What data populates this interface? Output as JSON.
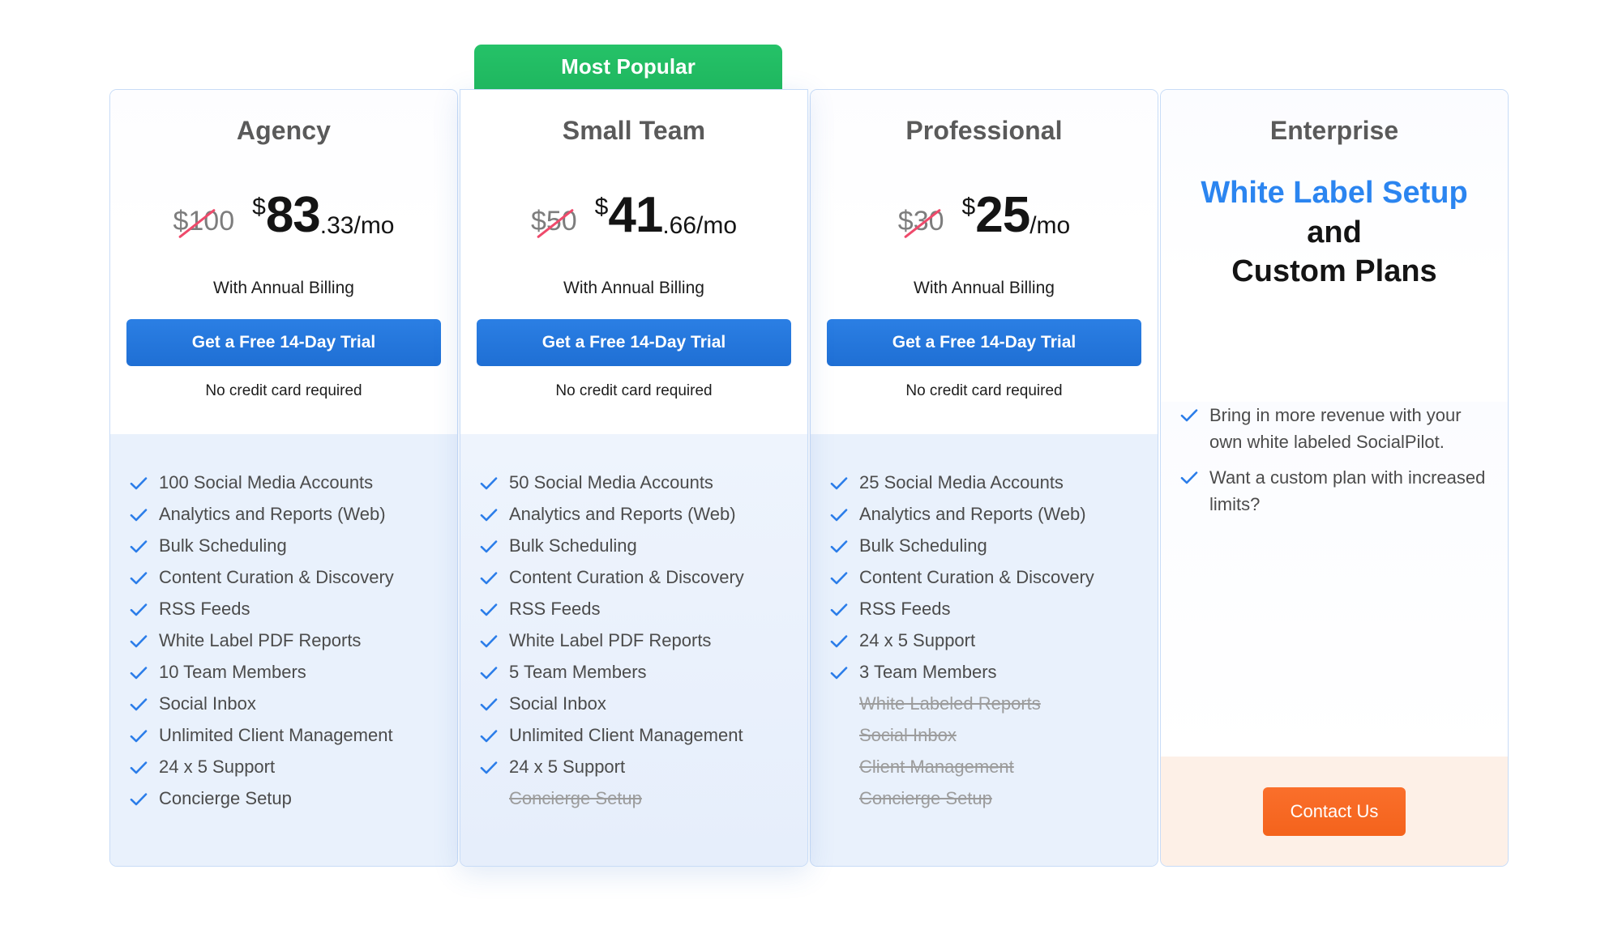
{
  "badge": {
    "label": "Most Popular"
  },
  "colors": {
    "accent_blue": "#2b7de9",
    "badge_green": "#1fb75f",
    "contact_orange": "#f4631c",
    "strike_red": "#ef4a6b",
    "feature_bg": "#e9f1fc",
    "enterprise_footer_bg": "#fdf0e7",
    "muted_text": "#9c9c9c"
  },
  "plans": [
    {
      "name": "Agency",
      "old_price": "$100",
      "currency": "$",
      "price_int": "83",
      "price_frac": ".33/mo",
      "billing_note": "With Annual Billing",
      "cta_label": "Get a Free 14-Day Trial",
      "cta_note": "No credit card required",
      "features": [
        {
          "label": "100 Social Media Accounts",
          "included": true
        },
        {
          "label": "Analytics and Reports (Web)",
          "included": true
        },
        {
          "label": "Bulk Scheduling",
          "included": true
        },
        {
          "label": "Content Curation & Discovery",
          "included": true
        },
        {
          "label": "RSS Feeds",
          "included": true
        },
        {
          "label": "White Label PDF Reports",
          "included": true
        },
        {
          "label": "10 Team Members",
          "included": true
        },
        {
          "label": "Social Inbox",
          "included": true
        },
        {
          "label": "Unlimited Client Management",
          "included": true
        },
        {
          "label": "24 x 5 Support",
          "included": true
        },
        {
          "label": "Concierge Setup",
          "included": true
        }
      ]
    },
    {
      "name": "Small Team",
      "old_price": "$50",
      "currency": "$",
      "price_int": "41",
      "price_frac": ".66/mo",
      "billing_note": "With Annual Billing",
      "cta_label": "Get a Free 14-Day Trial",
      "cta_note": "No credit card required",
      "popular": true,
      "features": [
        {
          "label": "50 Social Media Accounts",
          "included": true
        },
        {
          "label": "Analytics and Reports (Web)",
          "included": true
        },
        {
          "label": "Bulk Scheduling",
          "included": true
        },
        {
          "label": "Content Curation & Discovery",
          "included": true
        },
        {
          "label": "RSS Feeds",
          "included": true
        },
        {
          "label": "White Label PDF Reports",
          "included": true
        },
        {
          "label": "5 Team Members",
          "included": true
        },
        {
          "label": "Social Inbox",
          "included": true
        },
        {
          "label": "Unlimited Client Management",
          "included": true
        },
        {
          "label": "24 x 5 Support",
          "included": true
        },
        {
          "label": "Concierge Setup",
          "included": false
        }
      ]
    },
    {
      "name": "Professional",
      "old_price": "$30",
      "currency": "$",
      "price_int": "25",
      "price_frac": "/mo",
      "billing_note": "With Annual Billing",
      "cta_label": "Get a Free 14-Day Trial",
      "cta_note": "No credit card required",
      "features": [
        {
          "label": "25 Social Media Accounts",
          "included": true
        },
        {
          "label": "Analytics and Reports (Web)",
          "included": true
        },
        {
          "label": "Bulk Scheduling",
          "included": true
        },
        {
          "label": "Content Curation & Discovery",
          "included": true
        },
        {
          "label": "RSS Feeds",
          "included": true
        },
        {
          "label": "24 x 5 Support",
          "included": true
        },
        {
          "label": "3 Team Members",
          "included": true
        },
        {
          "label": "White Labeled Reports",
          "included": false
        },
        {
          "label": "Social Inbox",
          "included": false
        },
        {
          "label": "Client Management",
          "included": false
        },
        {
          "label": "Concierge Setup",
          "included": false
        }
      ]
    }
  ],
  "enterprise": {
    "name": "Enterprise",
    "tagline_blue": "White Label Setup",
    "tagline_rest_1": " and",
    "tagline_rest_2": "Custom Plans",
    "features": [
      "Bring in more revenue with your own white labeled SocialPilot.",
      "Want a custom plan with increased limits?"
    ],
    "cta_label": "Contact Us"
  }
}
